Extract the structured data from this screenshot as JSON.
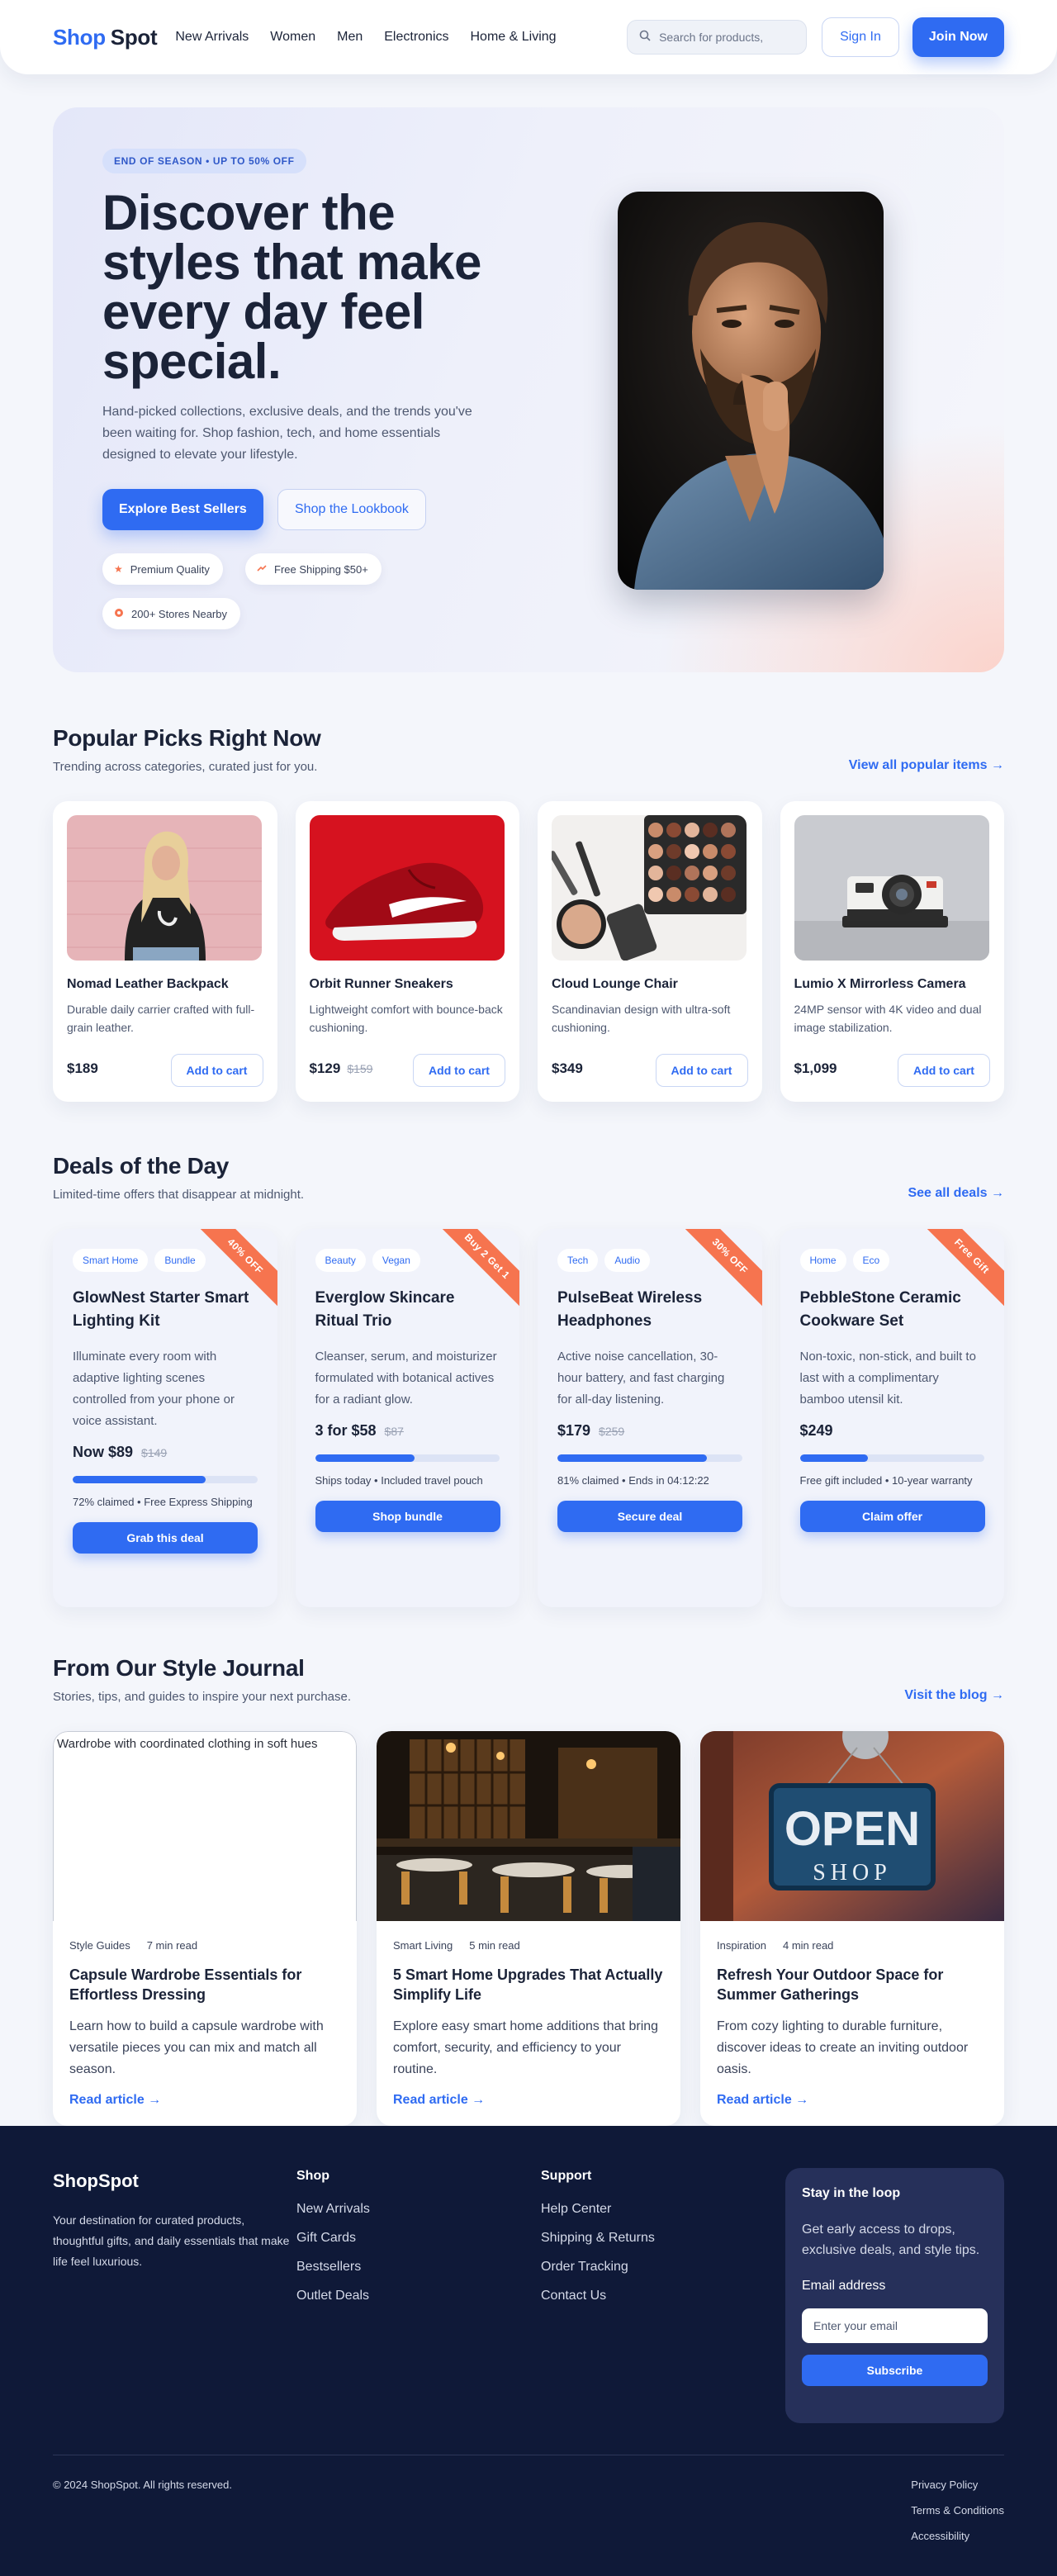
{
  "header": {
    "logo_part1": "Shop",
    "logo_part2": "Spot",
    "nav": [
      "New Arrivals",
      "Women",
      "Men",
      "Electronics",
      "Home & Living"
    ],
    "search_placeholder": "Search for products,",
    "sign_in": "Sign In",
    "join": "Join Now"
  },
  "hero": {
    "badge": "END OF SEASON • UP TO 50% OFF",
    "title": "Discover the styles that make every day feel special.",
    "subtitle": "Hand-picked collections, exclusive deals, and the trends you've been waiting for. Shop fashion, tech, and home essentials designed to elevate your lifestyle.",
    "primary_cta": "Explore Best Sellers",
    "secondary_cta": "Shop the Lookbook",
    "pills": [
      "Premium Quality",
      "Free Shipping $50+",
      "200+ Stores Nearby"
    ]
  },
  "popular": {
    "title": "Popular Picks Right Now",
    "subtitle": "Trending across categories, curated just for you.",
    "link": "View all popular items →",
    "add_label": "Add to cart",
    "items": [
      {
        "name": "Nomad Leather Backpack",
        "desc": "Durable daily carrier crafted with full-grain leather.",
        "price": "$189",
        "old": ""
      },
      {
        "name": "Orbit Runner Sneakers",
        "desc": "Lightweight comfort with bounce-back cushioning.",
        "price": "$129",
        "old": "$159"
      },
      {
        "name": "Cloud Lounge Chair",
        "desc": "Scandinavian design with ultra-soft cushioning.",
        "price": "$349",
        "old": ""
      },
      {
        "name": "Lumio X Mirrorless Camera",
        "desc": "24MP sensor with 4K video and dual image stabilization.",
        "price": "$1,099",
        "old": ""
      }
    ]
  },
  "deals": {
    "title": "Deals of the Day",
    "subtitle": "Limited-time offers that disappear at midnight.",
    "link": "See all deals →",
    "items": [
      {
        "tags": [
          "Smart Home",
          "Bundle"
        ],
        "ribbon": "40% OFF",
        "name": "GlowNest Starter Smart Lighting Kit",
        "desc": "Illuminate every room with adaptive lighting scenes controlled from your phone or voice assistant.",
        "price": "Now $89",
        "old": "$149",
        "claimed": 0.72,
        "note": "72% claimed • Free Express Shipping",
        "cta": "Grab this deal"
      },
      {
        "tags": [
          "Beauty",
          "Vegan"
        ],
        "ribbon": "Buy 2 Get 1",
        "name": "Everglow Skincare Ritual Trio",
        "desc": "Cleanser, serum, and moisturizer formulated with botanical actives for a radiant glow.",
        "price": "3 for $58",
        "old": "$87",
        "claimed": 0.54,
        "note": "Ships today • Included travel pouch",
        "cta": "Shop bundle"
      },
      {
        "tags": [
          "Tech",
          "Audio"
        ],
        "ribbon": "30% OFF",
        "name": "PulseBeat Wireless Headphones",
        "desc": "Active noise cancellation, 30-hour battery, and fast charging for all-day listening.",
        "price": "$179",
        "old": "$259",
        "claimed": 0.81,
        "note": "81% claimed • Ends in 04:12:22",
        "cta": "Secure deal"
      },
      {
        "tags": [
          "Home",
          "Eco"
        ],
        "ribbon": "Free Gift",
        "name": "PebbleStone Ceramic Cookware Set",
        "desc": "Non-toxic, non-stick, and built to last with a complimentary bamboo utensil kit.",
        "price": "$249",
        "old": "",
        "claimed": 0.37,
        "note": "Free gift included • 10-year warranty",
        "cta": "Claim offer"
      }
    ]
  },
  "journal": {
    "title": "From Our Style Journal",
    "subtitle": "Stories, tips, and guides to inspire your next purchase.",
    "link": "Visit the blog →",
    "read_label": "Read article →",
    "items": [
      {
        "alt": "Wardrobe with coordinated clothing in soft hues",
        "category": "Style Guides",
        "time": "7 min read",
        "title": "Capsule Wardrobe Essentials for Effortless Dressing",
        "desc": "Learn how to build a capsule wardrobe with versatile pieces you can mix and match all season."
      },
      {
        "alt": "",
        "category": "Smart Living",
        "time": "5 min read",
        "title": "5 Smart Home Upgrades That Actually Simplify Life",
        "desc": "Explore easy smart home additions that bring comfort, security, and efficiency to your routine."
      },
      {
        "alt": "",
        "category": "Inspiration",
        "time": "4 min read",
        "title": "Refresh Your Outdoor Space for Summer Gatherings",
        "desc": "From cozy lighting to durable furniture, discover ideas to create an inviting outdoor oasis.",
        "sign_word1": "OPEN",
        "sign_word2": "SHOP"
      }
    ]
  },
  "footer": {
    "brand": "ShopSpot",
    "about": "Your destination for curated products, thoughtful gifts, and daily essentials that make life feel luxurious.",
    "shop_title": "Shop",
    "shop_links": [
      "New Arrivals",
      "Gift Cards",
      "Bestsellers",
      "Outlet Deals"
    ],
    "support_title": "Support",
    "support_links": [
      "Help Center",
      "Shipping & Returns",
      "Order Tracking",
      "Contact Us"
    ],
    "news_title": "Stay in the loop",
    "news_text": "Get early access to drops, exclusive deals, and style tips.",
    "email_label": "Email address",
    "email_placeholder": "Enter your email",
    "subscribe": "Subscribe",
    "copyright": "© 2024 ShopSpot. All rights reserved.",
    "legal": [
      "Privacy Policy",
      "Terms & Conditions",
      "Accessibility"
    ]
  },
  "colors": {
    "accent": "#2f6bf2",
    "ribbon": "#f6744f",
    "footer_bg": "#0f1938"
  }
}
